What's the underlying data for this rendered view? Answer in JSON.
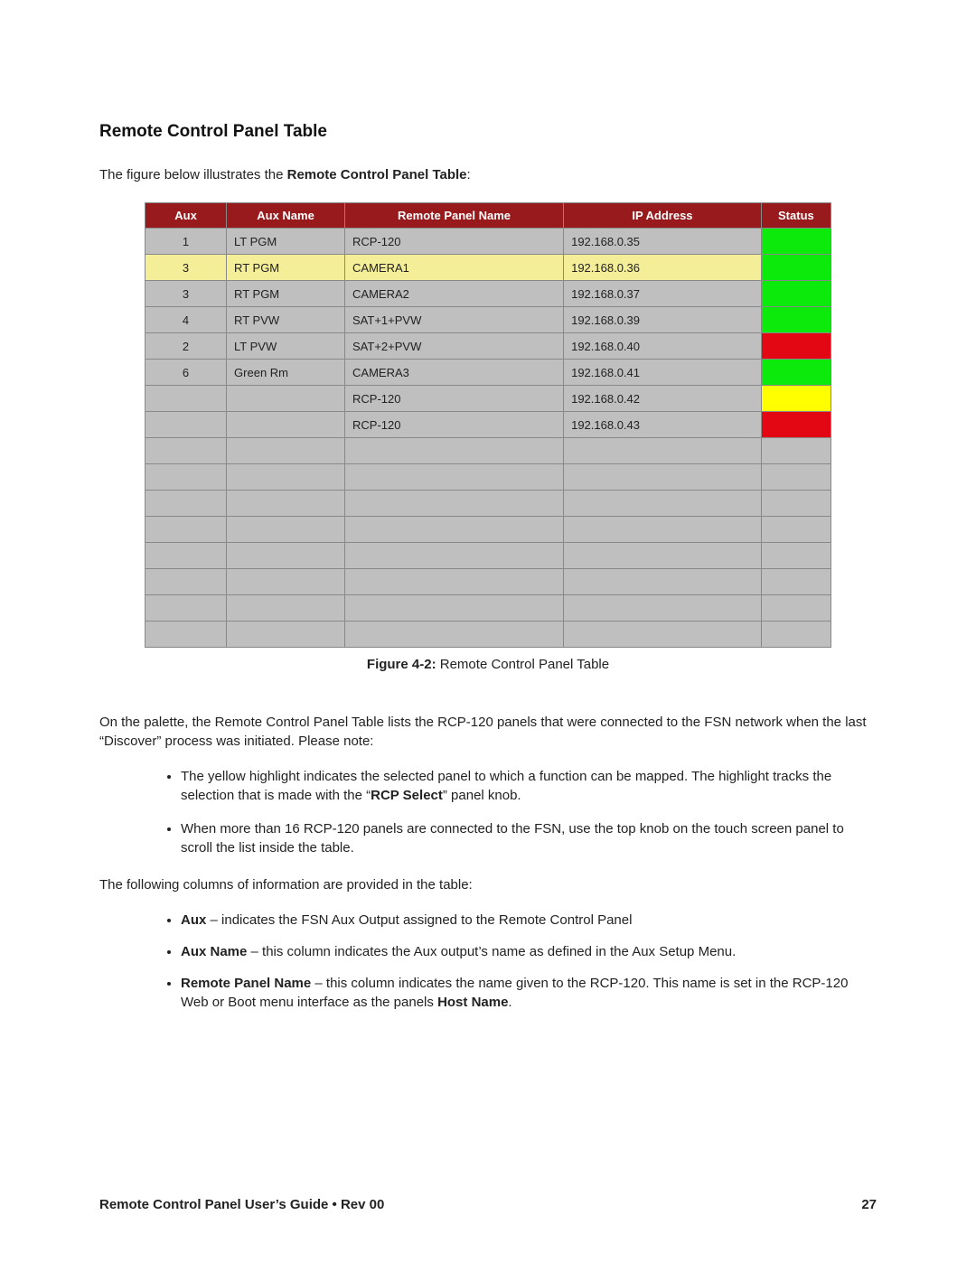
{
  "title": "Remote Control Panel Table",
  "intro_pre": "The figure below illustrates the ",
  "intro_bold": "Remote Control Panel Table",
  "intro_post": ":",
  "headers": {
    "aux": "Aux",
    "auxname": "Aux Name",
    "panel": "Remote Panel Name",
    "ip": "IP Address",
    "status": "Status"
  },
  "chart_data": {
    "type": "table",
    "title": "Remote Control Panel Table",
    "columns": [
      "Aux",
      "Aux Name",
      "Remote Panel Name",
      "IP Address",
      "Status"
    ],
    "rows": [
      {
        "aux": "1",
        "auxname": "LT PGM",
        "panel": "RCP-120",
        "ip": "192.168.0.35",
        "status": "green",
        "selected": false
      },
      {
        "aux": "3",
        "auxname": "RT PGM",
        "panel": "CAMERA1",
        "ip": "192.168.0.36",
        "status": "green",
        "selected": true
      },
      {
        "aux": "3",
        "auxname": "RT PGM",
        "panel": "CAMERA2",
        "ip": "192.168.0.37",
        "status": "green",
        "selected": false
      },
      {
        "aux": "4",
        "auxname": "RT PVW",
        "panel": "SAT+1+PVW",
        "ip": "192.168.0.39",
        "status": "green",
        "selected": false
      },
      {
        "aux": "2",
        "auxname": "LT PVW",
        "panel": "SAT+2+PVW",
        "ip": "192.168.0.40",
        "status": "red",
        "selected": false
      },
      {
        "aux": "6",
        "auxname": "Green Rm",
        "panel": "CAMERA3",
        "ip": "192.168.0.41",
        "status": "green",
        "selected": false
      },
      {
        "aux": "",
        "auxname": "",
        "panel": "RCP-120",
        "ip": "192.168.0.42",
        "status": "yellow",
        "selected": false
      },
      {
        "aux": "",
        "auxname": "",
        "panel": "RCP-120",
        "ip": "192.168.0.43",
        "status": "red",
        "selected": false
      },
      {
        "aux": "",
        "auxname": "",
        "panel": "",
        "ip": "",
        "status": "",
        "selected": false
      },
      {
        "aux": "",
        "auxname": "",
        "panel": "",
        "ip": "",
        "status": "",
        "selected": false
      },
      {
        "aux": "",
        "auxname": "",
        "panel": "",
        "ip": "",
        "status": "",
        "selected": false
      },
      {
        "aux": "",
        "auxname": "",
        "panel": "",
        "ip": "",
        "status": "",
        "selected": false
      },
      {
        "aux": "",
        "auxname": "",
        "panel": "",
        "ip": "",
        "status": "",
        "selected": false
      },
      {
        "aux": "",
        "auxname": "",
        "panel": "",
        "ip": "",
        "status": "",
        "selected": false
      },
      {
        "aux": "",
        "auxname": "",
        "panel": "",
        "ip": "",
        "status": "",
        "selected": false
      },
      {
        "aux": "",
        "auxname": "",
        "panel": "",
        "ip": "",
        "status": "",
        "selected": false
      }
    ]
  },
  "caption_bold": "Figure 4-2:",
  "caption_rest": " Remote Control Panel Table",
  "para1": "On the palette, the Remote Control Panel Table lists the RCP-120 panels that were connected to the FSN network when the last “Discover” process was initiated. Please note:",
  "bullets1": [
    {
      "pre": "The yellow highlight indicates the selected panel to which a function can be mapped. The highlight tracks the selection that is made with the “",
      "bold": "RCP Select",
      "post": "” panel knob."
    },
    {
      "pre": "When more than 16 RCP-120 panels are connected to the FSN, use the top knob on the touch screen panel to scroll the list inside the table.",
      "bold": "",
      "post": ""
    }
  ],
  "para2": "The following columns of information are provided in the table:",
  "bullets2": [
    {
      "bold": "Aux",
      "rest": " – indicates the FSN Aux Output assigned to the Remote Control Panel"
    },
    {
      "bold": "Aux Name",
      "rest": " – this column indicates the Aux output’s name as defined in the Aux Setup Menu."
    },
    {
      "bold": "Remote Panel Name",
      "rest": " – this column indicates the name given to the RCP-120. This name is set in the RCP-120 Web or Boot menu interface as the panels ",
      "bold2": "Host Name",
      "post": "."
    }
  ],
  "footer_left": "Remote Control Panel User’s Guide • Rev 00",
  "footer_right": "27"
}
